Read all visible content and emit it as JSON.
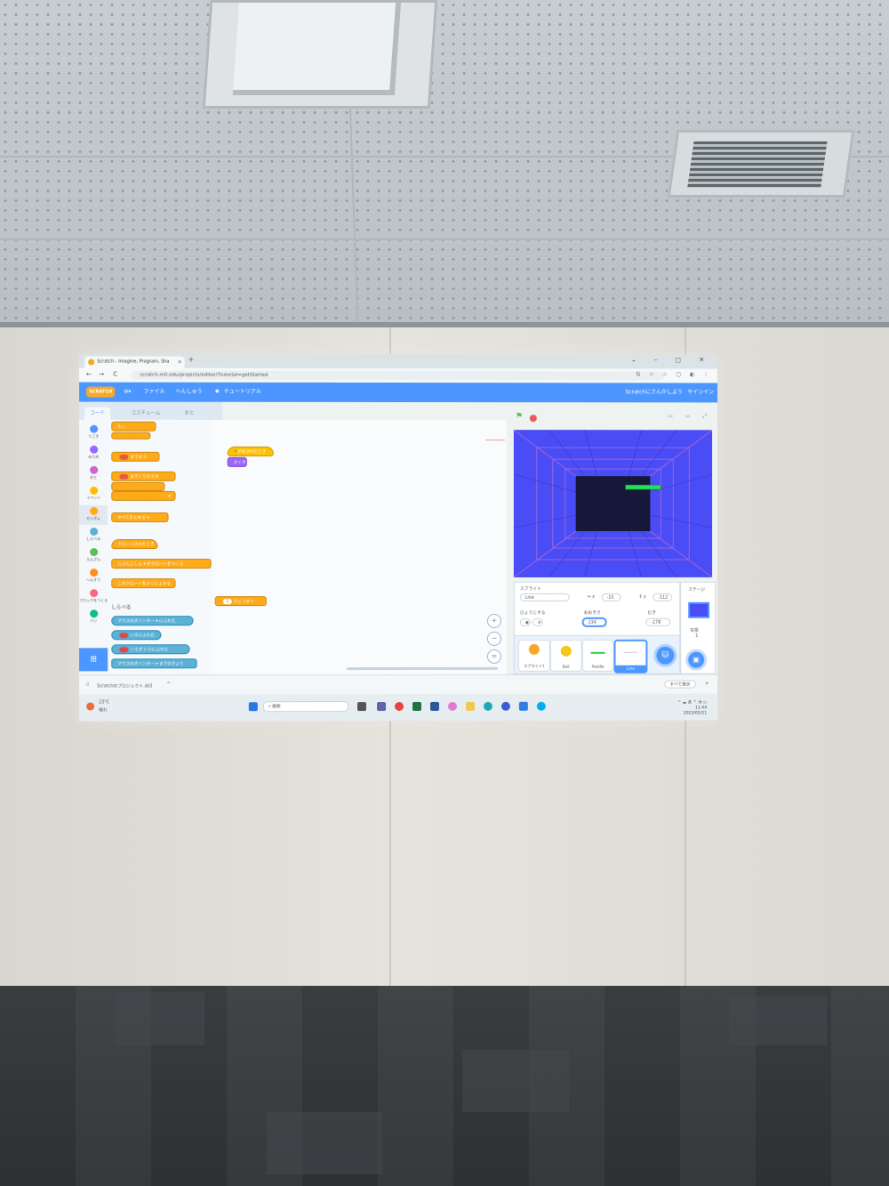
{
  "browser": {
    "tab_title": "Scratch - Imagine, Program, Sha",
    "tab_close": "×",
    "new_tab": "+",
    "window_controls": "⌄ – ▢ ✕",
    "nav": {
      "back": "←",
      "forward": "→",
      "reload": "C"
    },
    "url": "scratch.mit.edu/projects/editor/?tutorial=getStarted",
    "addr_icons": "G ☆ ☆ ▢ ◐ ⋮"
  },
  "scratch_menu": {
    "logo": "SCRATCH",
    "language_icon": "globe-icon",
    "file": "ファイル",
    "edit": "へんしゅう",
    "tutorials": "チュートリアル",
    "join": "Scratchにさんかしよう",
    "signin": "サインイン"
  },
  "editor_tabs": {
    "code": "コード",
    "costumes": "コスチューム",
    "sounds": "おと"
  },
  "categories": [
    {
      "label": "うごき",
      "color": "#4c97ff"
    },
    {
      "label": "みため",
      "color": "#9966ff"
    },
    {
      "label": "おと",
      "color": "#cf63cf"
    },
    {
      "label": "イベント",
      "color": "#ffbf00"
    },
    {
      "label": "せいぎょ",
      "color": "#ffab19"
    },
    {
      "label": "しらべる",
      "color": "#5cb1d6"
    },
    {
      "label": "えんざん",
      "color": "#59c059"
    },
    {
      "label": "へんすう",
      "color": "#ff8c1a"
    },
    {
      "label": "ブロックをつくる",
      "color": "#ff6680"
    },
    {
      "label": "ペン",
      "color": "#0fbd8c"
    }
  ],
  "palette": {
    "blocks": [
      {
        "text": "もし",
        "type": "ctrl"
      },
      {
        "text": "までまつ",
        "type": "ctrl"
      },
      {
        "text": "までくりかえす",
        "type": "ctrl"
      },
      {
        "text": "↺",
        "type": "ctrl"
      },
      {
        "text": "すべてをとめる ▾",
        "type": "ctrl"
      },
      {
        "text": "クローンされたとき",
        "type": "ctrl"
      },
      {
        "text": "じぶんじしん ▾  のクローンをつくる",
        "type": "ctrl"
      },
      {
        "text": "このクローンをさくじょする",
        "type": "ctrl"
      }
    ],
    "section_title": "しらべる",
    "sensing_blocks": [
      {
        "text": "マウスのポインター ▾ にふれた",
        "type": "sens"
      },
      {
        "text": "いろにふれた",
        "type": "sens"
      },
      {
        "text": "いろが  いろにふれた",
        "type": "sens"
      },
      {
        "text": "マウスのポインター ▾ までのきょり",
        "type": "sens"
      }
    ]
  },
  "workspace": {
    "script1_hat": "がおされたとき",
    "script1_block": "かくす",
    "script2_block": "びょうまつ",
    "script2_value": "1",
    "zoom_in": "+",
    "zoom_out": "−",
    "zoom_reset": "="
  },
  "stage_header": {
    "flag": "⚑",
    "buttons": "▭ ▭ ⤢"
  },
  "sprite_info": {
    "sprite_label": "スプライト",
    "sprite_name": "Line",
    "x_label": "↔ x",
    "x_value": "-10",
    "y_label": "↕ y",
    "y_value": "-112",
    "show_label": "ひょうじする",
    "size_label": "おおきさ",
    "size_value": "234",
    "direction_label": "むき",
    "direction_value": "-178"
  },
  "sprites": [
    {
      "name": "スプライト1",
      "color": "#f7a829"
    },
    {
      "name": "Ball",
      "color": "#f5c518"
    },
    {
      "name": "Paddle",
      "color": "#2ecc40"
    },
    {
      "name": "Line",
      "color": "#cccccc"
    }
  ],
  "stage_panel": {
    "title": "ステージ",
    "backdrops_label": "背景",
    "backdrops_count": "1"
  },
  "download_bar": {
    "file": "Scratchのプロジェクト.sb3",
    "arrow": "^",
    "show_all": "すべて表示",
    "close": "✕"
  },
  "taskbar": {
    "weather_temp": "23°C",
    "weather_desc": "晴れ",
    "search": "検索",
    "time": "11:44",
    "date": "2023/05/21"
  },
  "colors": {
    "scratch_blue": "#4c97ff",
    "stage_bg": "#4d4dff",
    "control": "#ffab19"
  }
}
